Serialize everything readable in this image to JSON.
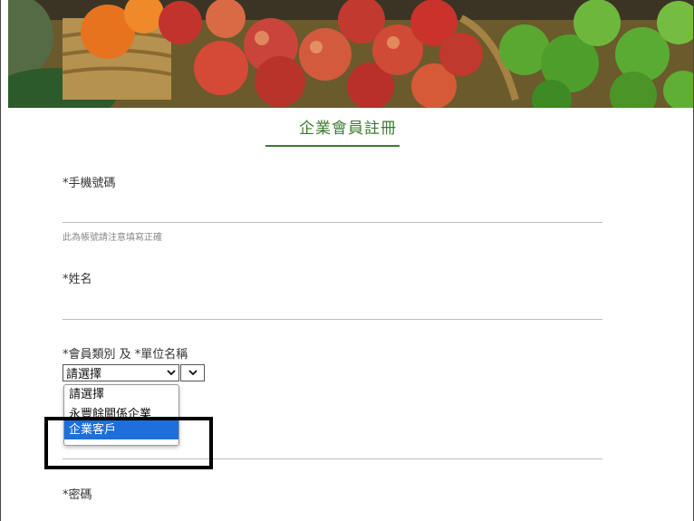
{
  "form": {
    "title": "企業會員註冊",
    "phone_label": "*手機號碼",
    "phone_hint": "此為帳號請注意填寫正確",
    "name_label": "*姓名",
    "member_type_label": "*會員類別 及 *單位名稱",
    "member_type_select": {
      "value": "請選擇",
      "icon": "chevron-down-icon"
    },
    "unit_select": {
      "value": "",
      "icon": "chevron-down-icon"
    },
    "member_type_options": [
      "請選擇",
      "永豐餘關係企業",
      "企業客戶"
    ],
    "selected_option": "企業客戶",
    "password_label": "*密碼"
  },
  "colors": {
    "accent": "#3a7d2c",
    "selection": "#1e6fd9"
  }
}
